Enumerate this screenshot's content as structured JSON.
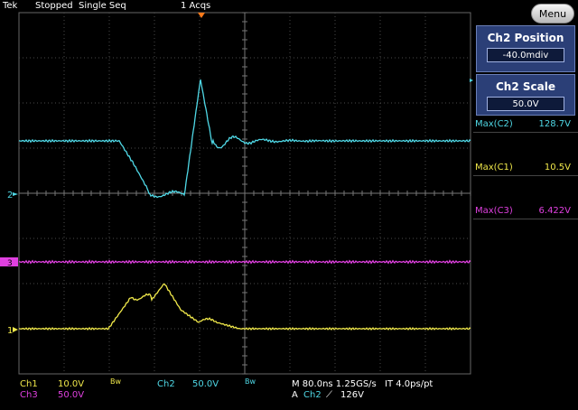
{
  "header": {
    "brand": "Tek",
    "status": "Stopped",
    "mode": "Single Seq",
    "acqs": "1 Acqs"
  },
  "side": {
    "menu_label": "Menu",
    "position_title": "Ch2 Position",
    "position_value": "-40.0mdiv",
    "scale_title": "Ch2 Scale",
    "scale_value": "50.0V"
  },
  "measurements": [
    {
      "label": "Max(C2)",
      "value": "128.7V",
      "color": "#4fd8e6"
    },
    {
      "label": "Max(C1)",
      "value": "10.5V",
      "color": "#f0e84a"
    },
    {
      "label": "Max(C3)",
      "value": "6.422V",
      "color": "#e040e0"
    }
  ],
  "markers": {
    "ch2": "2",
    "ch3": "3",
    "ch1": "1"
  },
  "bottom": {
    "ch1_label": "Ch1",
    "ch1_scale": "10.0V",
    "ch1_bw": "Bw",
    "ch2_label": "Ch2",
    "ch2_scale": "50.0V",
    "ch2_bw": "Bw",
    "ch3_label": "Ch3",
    "ch3_scale": "50.0V",
    "timebase": "M 80.0ns 1.25GS/s",
    "it": "IT 4.0ps/pt",
    "trigger_source_prefix": "A",
    "trigger_channel": "Ch2",
    "trigger_slope": "⟋",
    "trigger_level": "126V"
  },
  "colors": {
    "ch1": "#f0e84a",
    "ch2": "#4fd8e6",
    "ch3": "#e040e0",
    "grid": "#5a5a5a",
    "trigger": "#ff7a1a"
  }
}
